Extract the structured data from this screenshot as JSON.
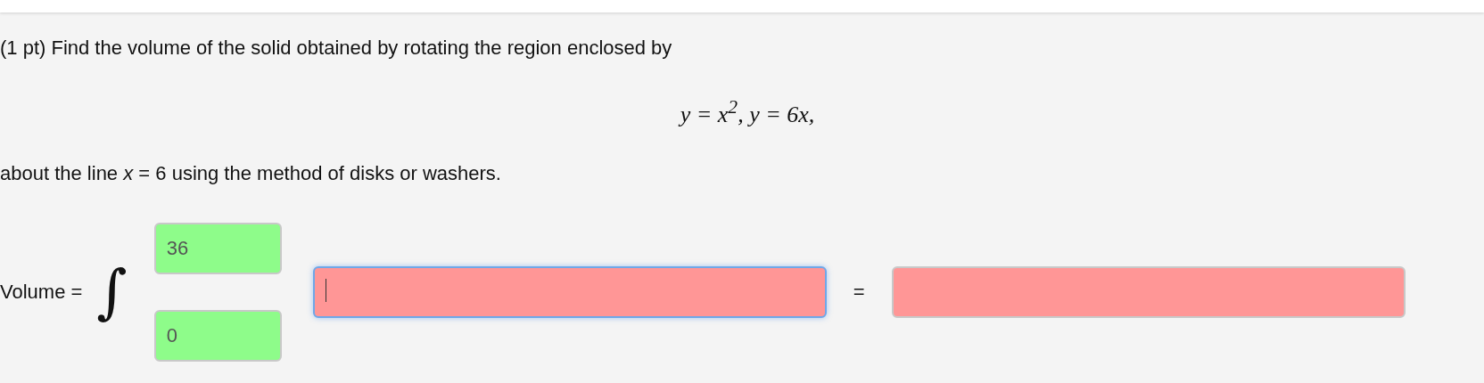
{
  "problem": {
    "prompt": "(1 pt) Find the volume of the solid obtained by rotating the region enclosed by",
    "equation": "y = x$^{2}$,  y = 6x,",
    "instruction": "about the line *x* = 6 using the method of disks or washers."
  },
  "answer": {
    "label": "Volume =",
    "integral_sign": "∫",
    "upper_limit": {
      "value": "36",
      "correct": true,
      "focused": false
    },
    "lower_limit": {
      "value": "0",
      "correct": true,
      "focused": false
    },
    "integrand": {
      "correct": false,
      "focused": true
    },
    "equals": "=",
    "result": {
      "correct": false,
      "focused": false
    }
  }
}
